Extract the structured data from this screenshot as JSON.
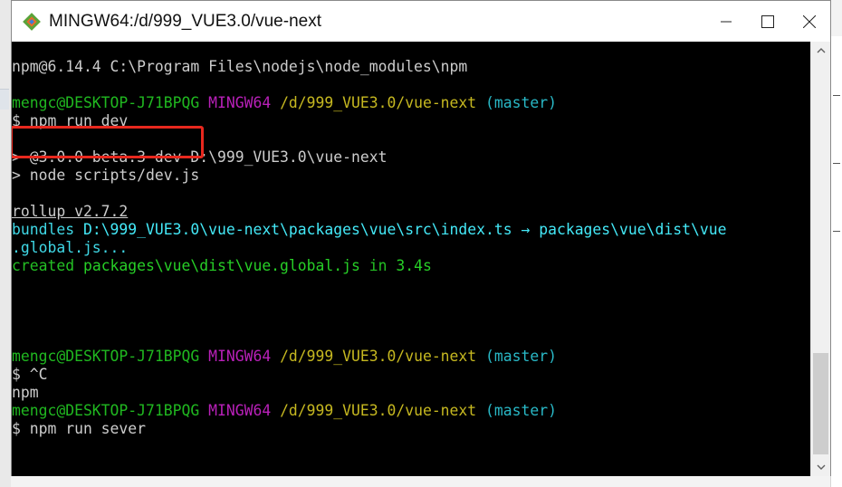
{
  "window": {
    "title": "MINGW64:/d/999_VUE3.0/vue-next",
    "icon": "git-bash-diamond-icon",
    "controls": [
      "minimize-icon",
      "maximize-icon",
      "close-icon"
    ]
  },
  "terminal": {
    "lines": [
      {
        "segments": [
          {
            "text": "npm@6.14.4 C:\\Program Files\\nodejs\\node_modules\\npm",
            "color": "#cccccc"
          }
        ]
      },
      {
        "segments": []
      },
      {
        "segments": [
          {
            "text": "mengc@DESKTOP-J71BPQG ",
            "color": "#20b820"
          },
          {
            "text": "MINGW64 ",
            "color": "#b820b8"
          },
          {
            "text": "/d/999_VUE3.0/vue-next ",
            "color": "#c6b820"
          },
          {
            "text": "(master)",
            "color": "#29b8c6"
          }
        ]
      },
      {
        "segments": [
          {
            "text": "$ npm run dev",
            "color": "#cccccc"
          }
        ]
      },
      {
        "segments": []
      },
      {
        "segments": [
          {
            "text": "> @3.0.0-beta.3 dev D:\\999_VUE3.0\\vue-next",
            "color": "#cccccc"
          }
        ]
      },
      {
        "segments": [
          {
            "text": "> node scripts/dev.js",
            "color": "#cccccc"
          }
        ]
      },
      {
        "segments": []
      },
      {
        "segments": [
          {
            "text": "rollup v2.7.2",
            "color": "#cccccc",
            "underline": true
          }
        ]
      },
      {
        "segments": [
          {
            "text": "bundles ",
            "color": "#3fd8e6"
          },
          {
            "text": "D:\\999_VUE3.0\\vue-next\\packages\\vue\\src\\index.ts → packages\\vue\\dist\\vue",
            "color": "#3fd8e6",
            "bold": true
          }
        ]
      },
      {
        "segments": [
          {
            "text": ".global.js...",
            "color": "#3fd8e6"
          }
        ]
      },
      {
        "segments": [
          {
            "text": "created ",
            "color": "#24c024"
          },
          {
            "text": "packages\\vue\\dist\\vue.global.js",
            "color": "#24c024",
            "bold": true
          },
          {
            "text": " in ",
            "color": "#24c024"
          },
          {
            "text": "3.4s",
            "color": "#24c024",
            "bold": true
          }
        ]
      },
      {
        "segments": []
      },
      {
        "segments": []
      },
      {
        "segments": []
      },
      {
        "segments": []
      },
      {
        "segments": [
          {
            "text": "mengc@DESKTOP-J71BPQG ",
            "color": "#20b820"
          },
          {
            "text": "MINGW64 ",
            "color": "#b820b8"
          },
          {
            "text": "/d/999_VUE3.0/vue-next ",
            "color": "#c6b820"
          },
          {
            "text": "(master)",
            "color": "#29b8c6"
          }
        ]
      },
      {
        "segments": [
          {
            "text": "$ ^C",
            "color": "#cccccc"
          }
        ]
      },
      {
        "segments": [
          {
            "text": "npm",
            "color": "#cccccc"
          }
        ]
      },
      {
        "segments": [
          {
            "text": "mengc@DESKTOP-J71BPQG ",
            "color": "#20b820"
          },
          {
            "text": "MINGW64 ",
            "color": "#b820b8"
          },
          {
            "text": "/d/999_VUE3.0/vue-next ",
            "color": "#c6b820"
          },
          {
            "text": "(master)",
            "color": "#29b8c6"
          }
        ]
      },
      {
        "segments": [
          {
            "text": "$ npm run sever",
            "color": "#cccccc"
          }
        ]
      }
    ],
    "highlight_color": "#e8281e"
  },
  "scrollbar": {
    "up": "chevron-up-icon",
    "down": "chevron-down-icon"
  }
}
